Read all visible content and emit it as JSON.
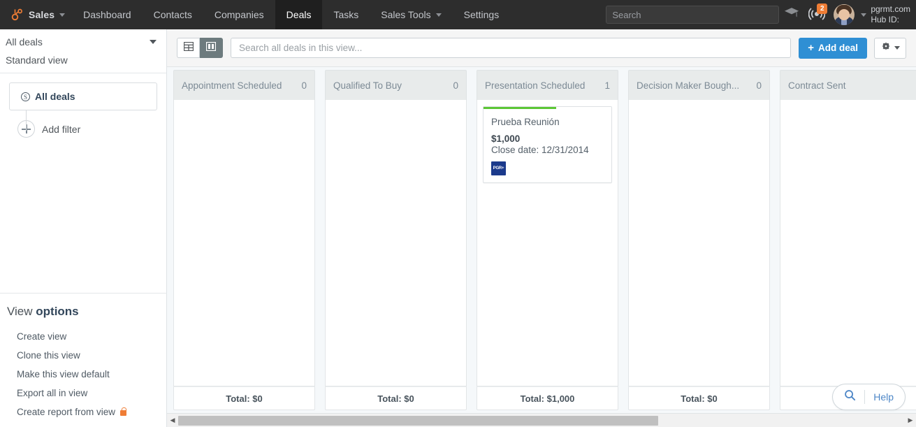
{
  "topnav": {
    "brand": {
      "label": "Sales",
      "logo_icon": "hubspot-sprocket-icon",
      "caret_icon": "chevron-down-icon"
    },
    "items": [
      {
        "label": "Dashboard",
        "active": false,
        "has_caret": false
      },
      {
        "label": "Contacts",
        "active": false,
        "has_caret": false
      },
      {
        "label": "Companies",
        "active": false,
        "has_caret": false
      },
      {
        "label": "Deals",
        "active": true,
        "has_caret": false
      },
      {
        "label": "Tasks",
        "active": false,
        "has_caret": false
      },
      {
        "label": "Sales Tools",
        "active": false,
        "has_caret": true
      },
      {
        "label": "Settings",
        "active": false,
        "has_caret": false
      }
    ],
    "search": {
      "placeholder": "Search",
      "value": ""
    },
    "academy_icon": "graduation-cap-icon",
    "notifications": {
      "icon": "broadcast-icon",
      "badge": "2"
    },
    "avatar_icon": "user-avatar",
    "account_caret_icon": "chevron-down-icon",
    "account": {
      "domain": "pgrmt.com",
      "hub_id": "Hub ID:"
    }
  },
  "sidebar": {
    "view_select": {
      "label": "All deals",
      "caret_icon": "caret-down-icon"
    },
    "view_subtitle": "Standard view",
    "filter": {
      "icon": "dollar-coin-icon",
      "label": "All deals"
    },
    "add_filter": {
      "icon": "plus-circle-icon",
      "label": "Add filter"
    },
    "view_options": {
      "title_light": "View ",
      "title_bold": "options",
      "links": [
        {
          "label": "Create view",
          "locked": false
        },
        {
          "label": "Clone this view",
          "locked": false
        },
        {
          "label": "Make this view default",
          "locked": false
        },
        {
          "label": "Export all in view",
          "locked": false
        },
        {
          "label": "Create report from view",
          "locked": true,
          "lock_icon": "lock-icon"
        }
      ]
    }
  },
  "toolbar": {
    "table_view_icon": "table-view-icon",
    "board_view_icon": "board-view-icon",
    "active_view": "board",
    "search": {
      "placeholder": "Search all deals in this view...",
      "value": ""
    },
    "add_deal_label": "Add deal",
    "add_deal_plus": "+",
    "settings_icon": "gear-icon",
    "settings_caret_icon": "caret-down-icon"
  },
  "board": {
    "columns": [
      {
        "name": "Appointment Scheduled",
        "count": "0",
        "total": "Total: $0",
        "cards": []
      },
      {
        "name": "Qualified To Buy",
        "count": "0",
        "total": "Total: $0",
        "cards": []
      },
      {
        "name": "Presentation Scheduled",
        "count": "1",
        "total": "Total: $1,000",
        "cards": [
          {
            "title": "Prueba Reunión",
            "amount": "$1,000",
            "close_date": "Close date: 12/31/2014",
            "progress_pct": 57,
            "progress_color": "#5cc635",
            "logo_text": "PGR+",
            "logo_color": "#1b3a8c"
          }
        ]
      },
      {
        "name": "Decision Maker Bough...",
        "count": "0",
        "total": "Total: $0",
        "cards": []
      },
      {
        "name": "Contract Sent",
        "count": "",
        "total": "",
        "cards": []
      }
    ]
  },
  "scrollbar": {
    "left_arrow_icon": "triangle-left-icon",
    "right_arrow_icon": "triangle-right-icon"
  },
  "help": {
    "icon": "magnifier-icon",
    "label": "Help"
  },
  "colors": {
    "nav_bg": "#2d2d2d",
    "nav_active_bg": "#1f1f1f",
    "brand_orange": "#ef7d35",
    "primary_blue": "#2f8fd4",
    "link_blue": "#4e87c7",
    "column_header_bg": "#e8ebeb",
    "progress_green": "#5cc635"
  }
}
